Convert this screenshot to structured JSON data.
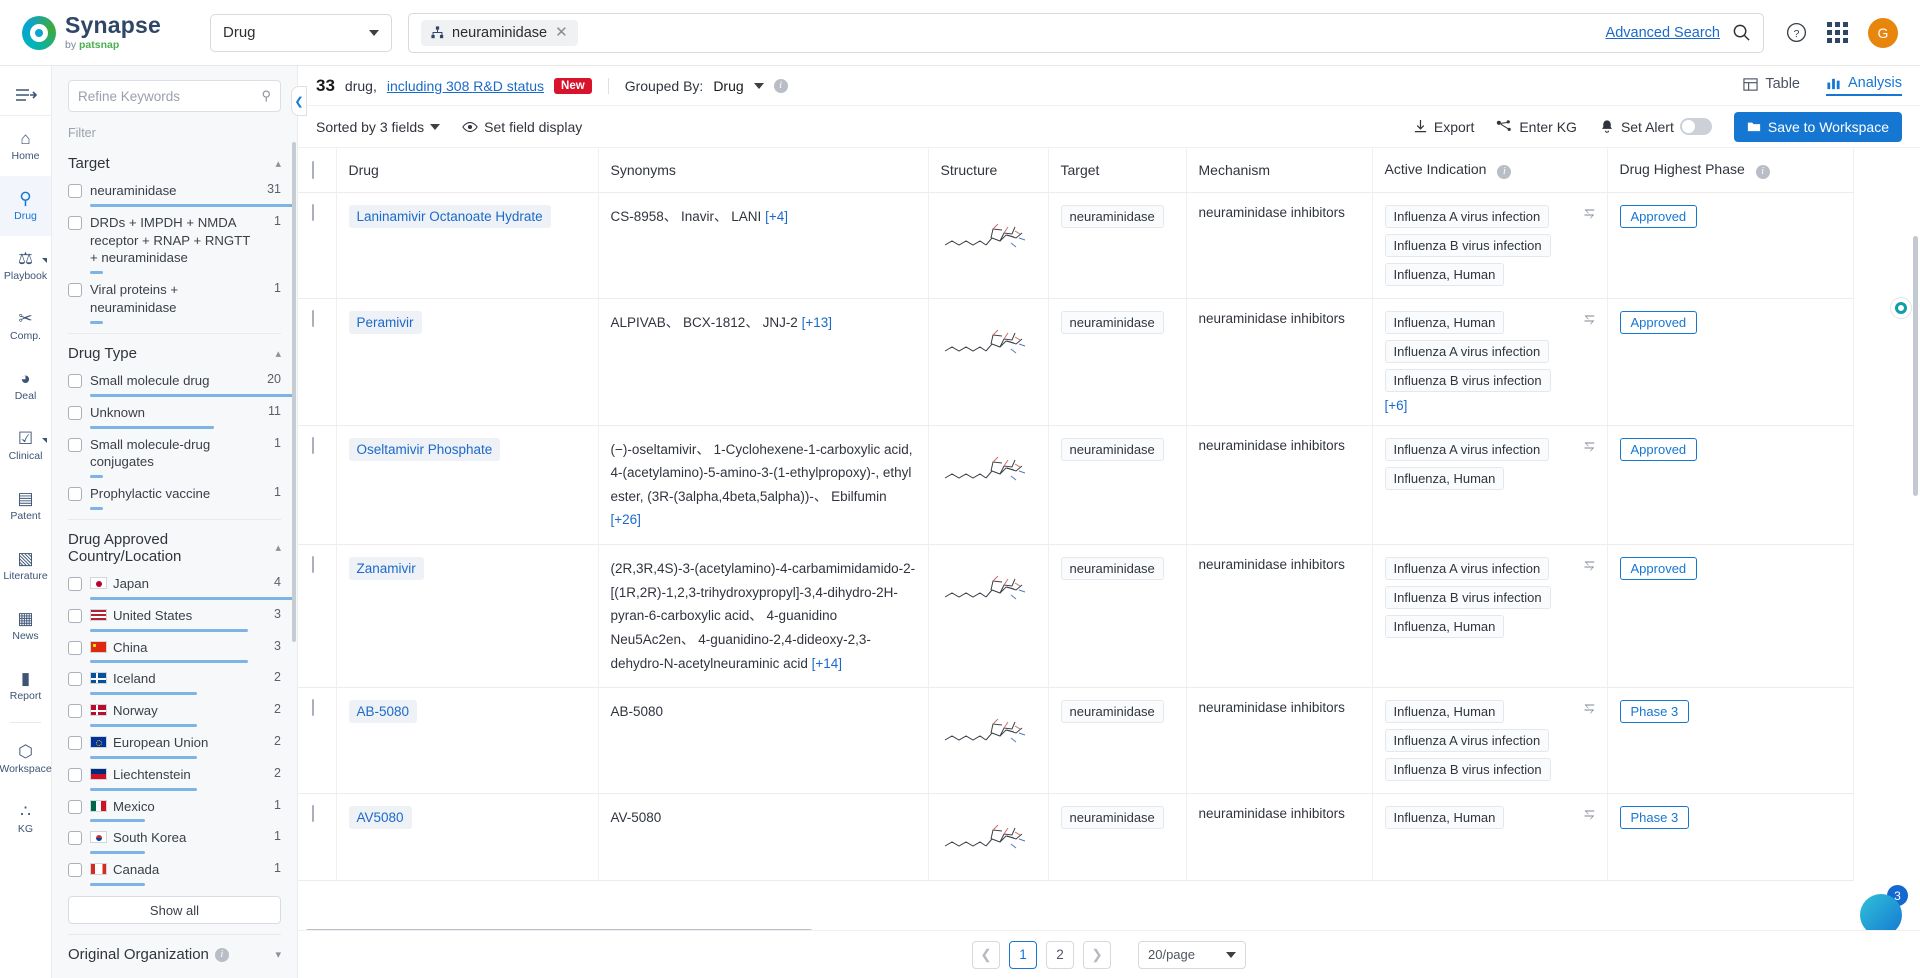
{
  "header": {
    "logo_name": "Synapse",
    "logo_sub_prefix": "by ",
    "logo_sub_brand": "patsnap",
    "entity_select": "Drug",
    "search_chip": "neuraminidase",
    "search_chip_icon": "hierarchy-icon",
    "advanced_search": "Advanced Search",
    "search_icon": "search-icon",
    "help_icon": "question-circle-icon",
    "apps_icon": "grid-apps-icon",
    "avatar_initial": "G"
  },
  "rail": {
    "toggle_icon": "collapse-sidebar-icon",
    "items": [
      {
        "label": "Home",
        "icon": "home-icon",
        "glyph": "⌂",
        "active": false,
        "arrow": false
      },
      {
        "label": "Drug",
        "icon": "capsule-icon",
        "glyph": "⚲",
        "active": true,
        "arrow": false
      },
      {
        "label": "Playbook",
        "icon": "playbook-icon",
        "glyph": "⚖",
        "active": false,
        "arrow": true
      },
      {
        "label": "Comp.",
        "icon": "scissors-icon",
        "glyph": "✂",
        "active": false,
        "arrow": false
      },
      {
        "label": "Deal",
        "icon": "deal-icon",
        "glyph": "◕",
        "active": false,
        "arrow": false
      },
      {
        "label": "Clinical",
        "icon": "clinical-icon",
        "glyph": "☑",
        "active": false,
        "arrow": true
      },
      {
        "label": "Patent",
        "icon": "patent-icon",
        "glyph": "▤",
        "active": false,
        "arrow": false
      },
      {
        "label": "Literature",
        "icon": "literature-icon",
        "glyph": "▧",
        "active": false,
        "arrow": false
      },
      {
        "label": "News",
        "icon": "news-icon",
        "glyph": "▦",
        "active": false,
        "arrow": false
      },
      {
        "label": "Report",
        "icon": "report-icon",
        "glyph": "▮",
        "active": false,
        "arrow": false
      }
    ],
    "bottom_items": [
      {
        "label": "Workspace",
        "icon": "workspace-icon",
        "glyph": "⬡",
        "active": false,
        "arrow": false
      },
      {
        "label": "KG",
        "icon": "knowledge-graph-icon",
        "glyph": "∴",
        "active": false,
        "arrow": false
      }
    ]
  },
  "filters": {
    "refine_placeholder": "Refine Keywords",
    "filter_label": "Filter",
    "groups": [
      {
        "title": "Target",
        "collapse_icon": "chevron-up-icon",
        "items": [
          {
            "label": "neuraminidase",
            "count": "31",
            "bar": 96
          },
          {
            "label": "DRDs + IMPDH + NMDA receptor + RNAP + RNGTT + neuraminidase",
            "count": "1",
            "bar": 6
          },
          {
            "label": "Viral proteins + neuraminidase",
            "count": "1",
            "bar": 6
          }
        ]
      },
      {
        "title": "Drug Type",
        "collapse_icon": "chevron-up-icon",
        "items": [
          {
            "label": "Small molecule drug",
            "count": "20",
            "bar": 96
          },
          {
            "label": "Unknown",
            "count": "11",
            "bar": 58
          },
          {
            "label": "Small molecule-drug conjugates",
            "count": "1",
            "bar": 6
          },
          {
            "label": "Prophylactic vaccine",
            "count": "1",
            "bar": 6
          }
        ]
      },
      {
        "title": "Drug Approved Country/Location",
        "collapse_icon": "chevron-up-icon",
        "items": [
          {
            "label": "Japan",
            "count": "4",
            "bar": 96,
            "flag": "jp"
          },
          {
            "label": "United States",
            "count": "3",
            "bar": 74,
            "flag": "us"
          },
          {
            "label": "China",
            "count": "3",
            "bar": 74,
            "flag": "cn"
          },
          {
            "label": "Iceland",
            "count": "2",
            "bar": 50,
            "flag": "is"
          },
          {
            "label": "Norway",
            "count": "2",
            "bar": 50,
            "flag": "no"
          },
          {
            "label": "European Union",
            "count": "2",
            "bar": 50,
            "flag": "eu"
          },
          {
            "label": "Liechtenstein",
            "count": "2",
            "bar": 50,
            "flag": "li"
          },
          {
            "label": "Mexico",
            "count": "1",
            "bar": 26,
            "flag": "mx"
          },
          {
            "label": "South Korea",
            "count": "1",
            "bar": 26,
            "flag": "kr"
          },
          {
            "label": "Canada",
            "count": "1",
            "bar": 26,
            "flag": "ca"
          }
        ]
      }
    ],
    "show_all": "Show all",
    "last_group_title": "Original Organization"
  },
  "results": {
    "count": "33",
    "unit": "drug,",
    "link": "including 308 R&D status",
    "new_badge": "New",
    "grouped_by_label": "Grouped By:",
    "grouped_by_value": "Drug",
    "tab_table": "Table",
    "tab_analysis": "Analysis"
  },
  "toolbar": {
    "sorted": "Sorted by 3 fields",
    "set_field_display": "Set field display",
    "export": "Export",
    "enter_kg": "Enter KG",
    "set_alert": "Set Alert",
    "save_workspace": "Save to Workspace"
  },
  "table": {
    "columns": [
      "Drug",
      "Synonyms",
      "Structure",
      "Target",
      "Mechanism",
      "Active Indication",
      "Drug Highest Phase"
    ],
    "rows": [
      {
        "drug": "Laninamivir Octanoate Hydrate",
        "synonyms": "CS-8958、 Inavir、 LANI",
        "synonyms_more": "[+4]",
        "target": "neuraminidase",
        "mechanism": "neuraminidase inhibitors",
        "indications": [
          "Influenza A virus infection",
          "Influenza B virus infection",
          "Influenza, Human"
        ],
        "indications_more": "",
        "phase": "Approved"
      },
      {
        "drug": "Peramivir",
        "synonyms": "ALPIVAB、 BCX-1812、 JNJ-2",
        "synonyms_more": "[+13]",
        "target": "neuraminidase",
        "mechanism": "neuraminidase inhibitors",
        "indications": [
          "Influenza, Human",
          "Influenza A virus infection",
          "Influenza B virus infection"
        ],
        "indications_more": "[+6]",
        "phase": "Approved"
      },
      {
        "drug": "Oseltamivir Phosphate",
        "synonyms": "(−)-oseltamivir、 1-Cyclohexene-1-carboxylic acid, 4-(acetylamino)-5-amino-3-(1-ethylpropoxy)-, ethyl ester, (3R-(3alpha,4beta,5alpha))-、 Ebilfumin",
        "synonyms_more": "[+26]",
        "target": "neuraminidase",
        "mechanism": "neuraminidase inhibitors",
        "indications": [
          "Influenza A virus infection",
          "Influenza, Human"
        ],
        "indications_more": "",
        "phase": "Approved"
      },
      {
        "drug": "Zanamivir",
        "synonyms": "(2R,3R,4S)-3-(acetylamino)-4-carbamimidamido-2-[(1R,2R)-1,2,3-trihydroxypropyl]-3,4-dihydro-2H-pyran-6-carboxylic acid、 4-guanidino Neu5Ac2en、 4-guanidino-2,4-dideoxy-2,3-dehydro-N-acetylneuraminic acid",
        "synonyms_more": "[+14]",
        "target": "neuraminidase",
        "mechanism": "neuraminidase inhibitors",
        "indications": [
          "Influenza A virus infection",
          "Influenza B virus infection",
          "Influenza, Human"
        ],
        "indications_more": "",
        "phase": "Approved"
      },
      {
        "drug": "AB-5080",
        "synonyms": "AB-5080",
        "synonyms_more": "",
        "target": "neuraminidase",
        "mechanism": "neuraminidase inhibitors",
        "indications": [
          "Influenza, Human",
          "Influenza A virus infection",
          "Influenza B virus infection"
        ],
        "indications_more": "",
        "phase": "Phase 3"
      },
      {
        "drug": "AV5080",
        "synonyms": "AV-5080",
        "synonyms_more": "",
        "target": "neuraminidase",
        "mechanism": "neuraminidase inhibitors",
        "indications": [
          "Influenza, Human"
        ],
        "indications_more": "",
        "phase": "Phase 3"
      }
    ]
  },
  "pagination": {
    "prev_icon": "chevron-left-icon",
    "next_icon": "chevron-right-icon",
    "pages": [
      "1",
      "2"
    ],
    "active_page": "1",
    "per_page": "20/page"
  },
  "floating": {
    "badge_count": "3",
    "assistant_icon": "ai-assistant-icon"
  },
  "colors": {
    "accent": "#1677d2",
    "link": "#1b6ac9",
    "danger": "#d8132c",
    "avatar": "#e8850d"
  }
}
